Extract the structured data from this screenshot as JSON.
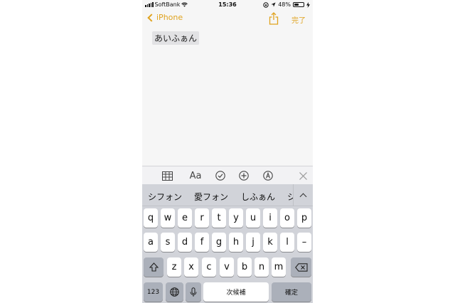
{
  "status_bar": {
    "carrier": "SoftBank",
    "time": "15:36",
    "battery_text": "48%",
    "battery_level": 0.48
  },
  "nav": {
    "back_label": "iPhone",
    "done_label": "完了"
  },
  "note": {
    "text": "あいふぁん"
  },
  "toolbar": {
    "items": [
      "table-icon",
      "text-format-icon",
      "checklist-icon",
      "add-icon",
      "sketch-icon",
      "close-icon"
    ],
    "format_label": "Aa"
  },
  "keyboard": {
    "candidates": [
      "シフォン",
      "愛フォン",
      "しふぁん",
      "シ"
    ],
    "row1": [
      "q",
      "w",
      "e",
      "r",
      "t",
      "y",
      "u",
      "i",
      "o",
      "p"
    ],
    "row2": [
      "a",
      "s",
      "d",
      "f",
      "g",
      "h",
      "j",
      "k",
      "l",
      "–"
    ],
    "row3": [
      "z",
      "x",
      "c",
      "v",
      "b",
      "n",
      "m"
    ],
    "numbers_label": "123",
    "next_candidate_label": "次候補",
    "confirm_label": "確定"
  },
  "colors": {
    "accent": "#e0a31f",
    "keyboard_bg": "#d1d3d9",
    "key_dark": "#abb0ba"
  }
}
